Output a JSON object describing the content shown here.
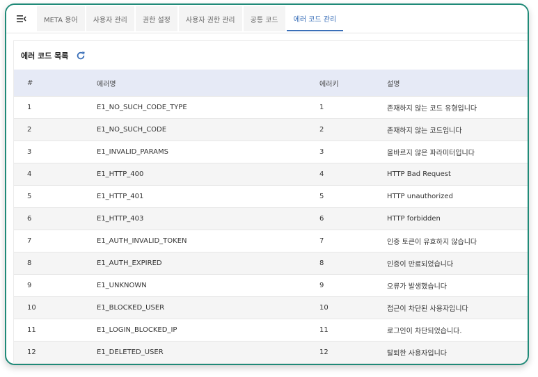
{
  "tabs": [
    {
      "label": "META 용어",
      "active": false
    },
    {
      "label": "사용자 관리",
      "active": false
    },
    {
      "label": "권한 설정",
      "active": false
    },
    {
      "label": "사용자 권한 관리",
      "active": false
    },
    {
      "label": "공통 코드",
      "active": false
    },
    {
      "label": "에러 코드 관리",
      "active": true
    }
  ],
  "icons": {
    "menu": "menu-collapse-icon",
    "refresh": "refresh-icon"
  },
  "colors": {
    "frame": "#1f8a78",
    "accent": "#3a6fb8",
    "header_bg": "#e6eaf6"
  },
  "section": {
    "title": "에러 코드 목록"
  },
  "table": {
    "headers": [
      "#",
      "에러명",
      "에러키",
      "설명"
    ],
    "rows": [
      [
        "1",
        "E1_NO_SUCH_CODE_TYPE",
        "1",
        "존재하지 않는 코드 유형입니다"
      ],
      [
        "2",
        "E1_NO_SUCH_CODE",
        "2",
        "존재하지 않는 코드입니다"
      ],
      [
        "3",
        "E1_INVALID_PARAMS",
        "3",
        "올바르지 않은 파라미터입니다"
      ],
      [
        "4",
        "E1_HTTP_400",
        "4",
        "HTTP Bad Request"
      ],
      [
        "5",
        "E1_HTTP_401",
        "5",
        "HTTP unauthorized"
      ],
      [
        "6",
        "E1_HTTP_403",
        "6",
        "HTTP forbidden"
      ],
      [
        "7",
        "E1_AUTH_INVALID_TOKEN",
        "7",
        "인증 토큰이 유효하지 않습니다"
      ],
      [
        "8",
        "E1_AUTH_EXPIRED",
        "8",
        "인증이 만료되었습니다"
      ],
      [
        "9",
        "E1_UNKNOWN",
        "9",
        "오류가 발생했습니다"
      ],
      [
        "10",
        "E1_BLOCKED_USER",
        "10",
        "접근이 차단된 사용자입니다"
      ],
      [
        "11",
        "E1_LOGIN_BLOCKED_IP",
        "11",
        "로그인이 차단되었습니다."
      ],
      [
        "12",
        "E1_DELETED_USER",
        "12",
        "탈퇴한 사용자입니다"
      ]
    ]
  }
}
